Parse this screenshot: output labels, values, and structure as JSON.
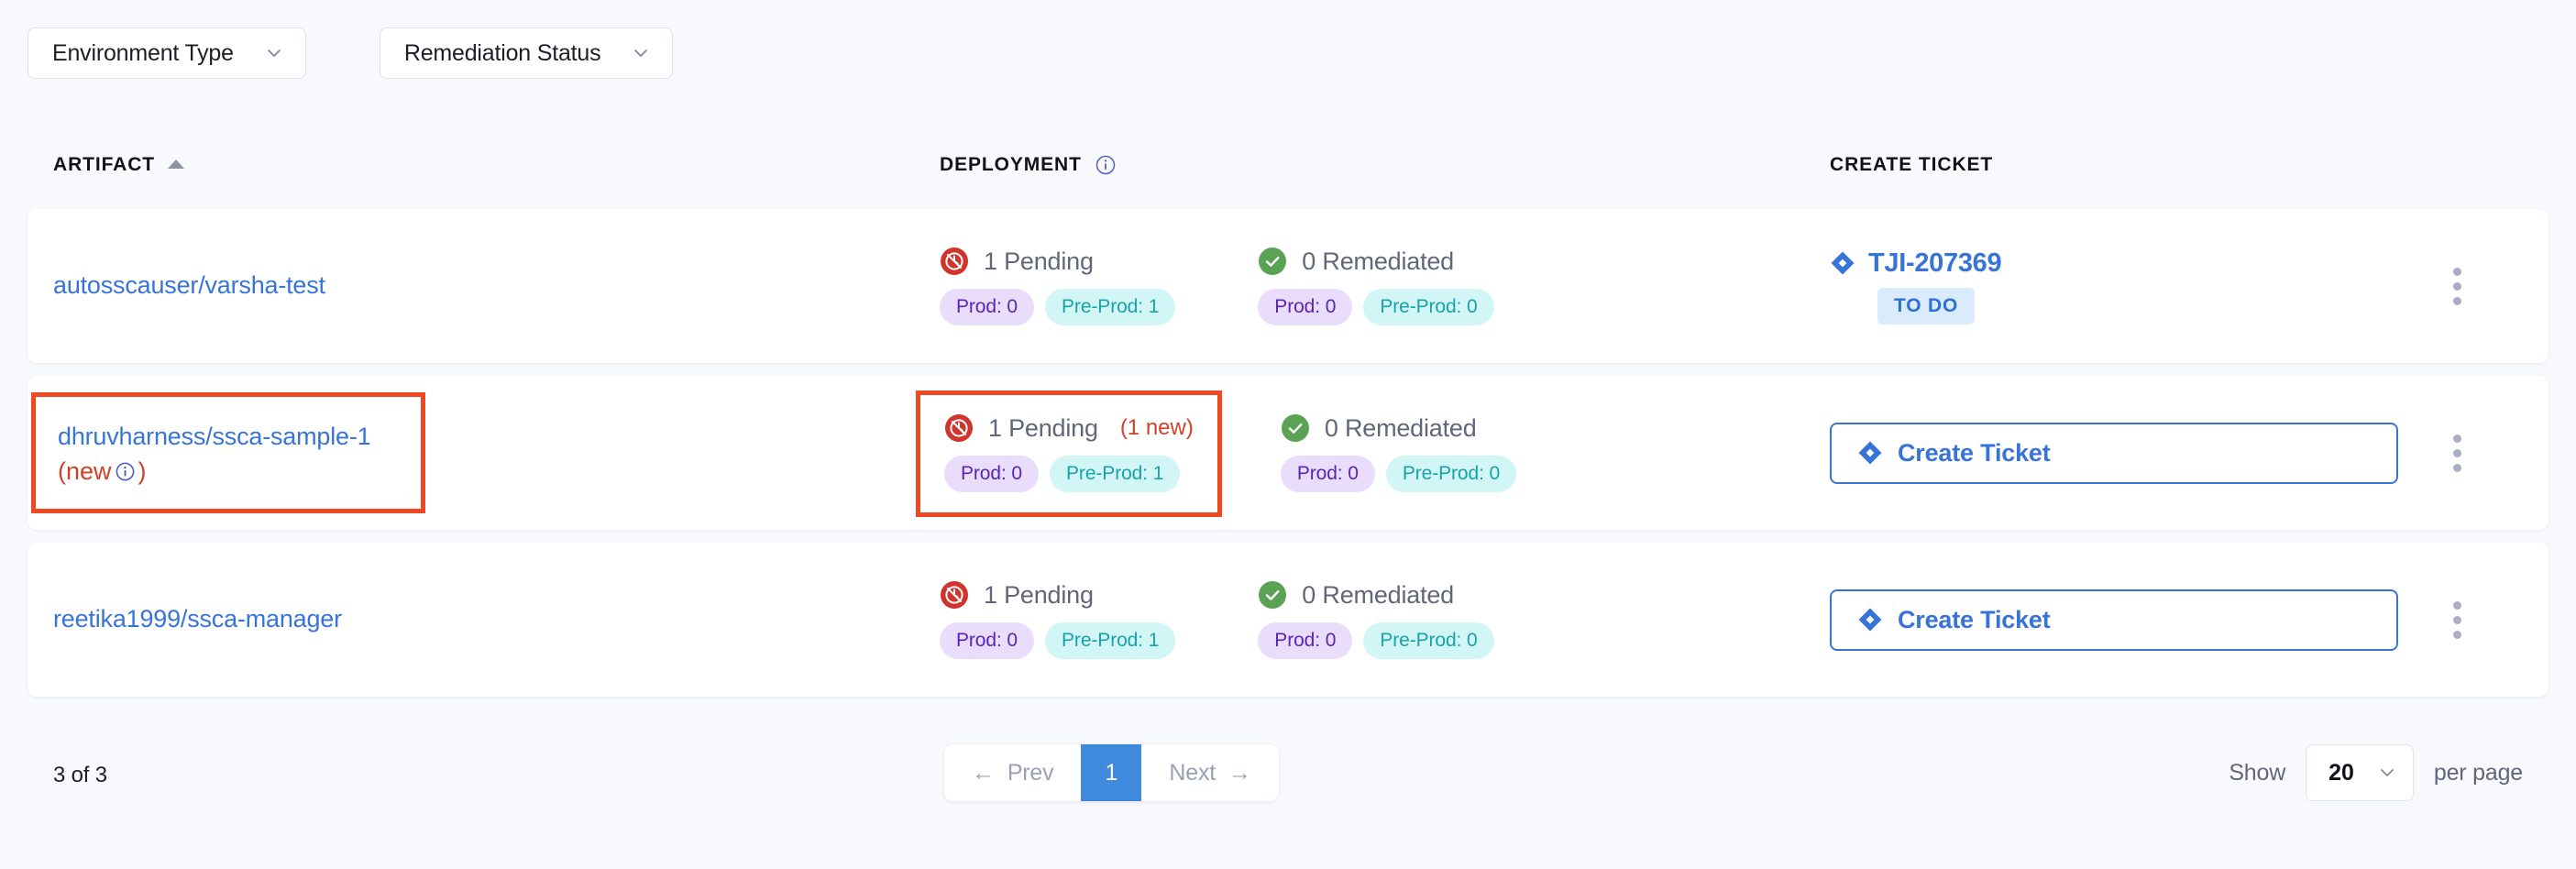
{
  "filters": [
    {
      "label": "Environment Type",
      "icon": "chevron-down-icon"
    },
    {
      "label": "Remediation Status",
      "icon": "chevron-down-icon"
    }
  ],
  "columns": {
    "artifact": "ARTIFACT",
    "deployment": "DEPLOYMENT",
    "create_ticket": "CREATE TICKET"
  },
  "colors": {
    "link": "#3874d8",
    "highlight_box": "#ef4923",
    "new_text": "#d2402a",
    "pending_icon": "#d0342c",
    "remediated_icon": "#5aa355",
    "chip_prod_bg": "#eadcfb",
    "chip_prod_fg": "#5a25b5",
    "chip_preprod_bg": "#d2f6f5",
    "chip_preprod_fg": "#18a2a9",
    "todo_bg": "#d9ebfc",
    "todo_fg": "#2d70d2",
    "page_active_bg": "#3f8add",
    "row_bg": "#ffffff",
    "page_bg": "#f8f9fc"
  },
  "rows": [
    {
      "artifact": {
        "name": "autosscauser/varsha-test",
        "new_suffix": "",
        "highlighted": false
      },
      "pending": {
        "icon": "pending-timer-icon",
        "label": "1 Pending",
        "new_badge": "",
        "chips": [
          {
            "label": "Prod: 0",
            "kind": "prod"
          },
          {
            "label": "Pre-Prod: 1",
            "kind": "preprod"
          }
        ],
        "highlighted": false
      },
      "remediated": {
        "icon": "check-circle-icon",
        "label": "0 Remediated",
        "chips": [
          {
            "label": "Prod: 0",
            "kind": "prod"
          },
          {
            "label": "Pre-Prod: 0",
            "kind": "preprod"
          }
        ]
      },
      "ticket": {
        "type": "link",
        "icon": "jira-icon",
        "id": "TJI-207369",
        "status": "TO DO",
        "button_label": ""
      },
      "menu": "kebab-menu-icon"
    },
    {
      "artifact": {
        "name": "dhruvharness/ssca-sample-1",
        "new_suffix": "(new",
        "highlighted": true
      },
      "pending": {
        "icon": "pending-timer-icon",
        "label": "1 Pending",
        "new_badge": "(1 new)",
        "chips": [
          {
            "label": "Prod: 0",
            "kind": "prod"
          },
          {
            "label": "Pre-Prod: 1",
            "kind": "preprod"
          }
        ],
        "highlighted": true
      },
      "remediated": {
        "icon": "check-circle-icon",
        "label": "0 Remediated",
        "chips": [
          {
            "label": "Prod: 0",
            "kind": "prod"
          },
          {
            "label": "Pre-Prod: 0",
            "kind": "preprod"
          }
        ]
      },
      "ticket": {
        "type": "button",
        "icon": "jira-icon",
        "id": "",
        "status": "",
        "button_label": "Create Ticket"
      },
      "menu": "kebab-menu-icon"
    },
    {
      "artifact": {
        "name": "reetika1999/ssca-manager",
        "new_suffix": "",
        "highlighted": false
      },
      "pending": {
        "icon": "pending-timer-icon",
        "label": "1 Pending",
        "new_badge": "",
        "chips": [
          {
            "label": "Prod: 0",
            "kind": "prod"
          },
          {
            "label": "Pre-Prod: 1",
            "kind": "preprod"
          }
        ],
        "highlighted": false
      },
      "remediated": {
        "icon": "check-circle-icon",
        "label": "0 Remediated",
        "chips": [
          {
            "label": "Prod: 0",
            "kind": "prod"
          },
          {
            "label": "Pre-Prod: 0",
            "kind": "preprod"
          }
        ]
      },
      "ticket": {
        "type": "button",
        "icon": "jira-icon",
        "id": "",
        "status": "",
        "button_label": "Create Ticket"
      },
      "menu": "kebab-menu-icon"
    }
  ],
  "footer": {
    "count": "3 of 3",
    "prev": "Prev",
    "page": "1",
    "next": "Next",
    "show": "Show",
    "per_page_value": "20",
    "per_page_suffix": "per page"
  }
}
